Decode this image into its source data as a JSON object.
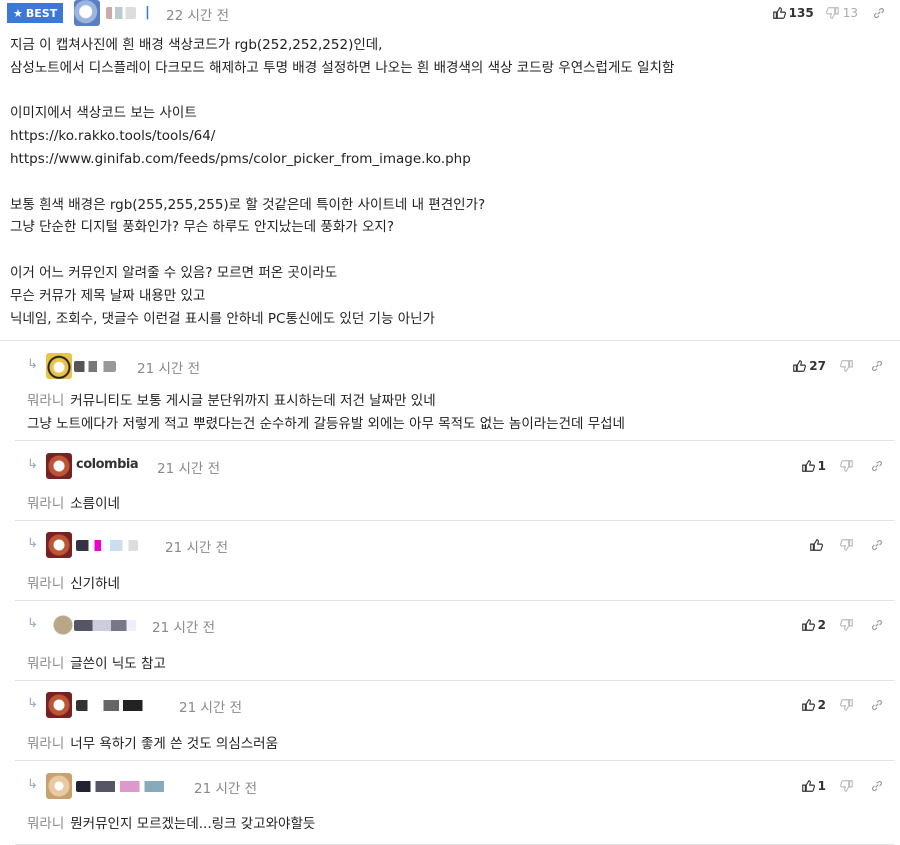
{
  "best": {
    "badge": "BEST",
    "time": "22 시간 전",
    "separator": "|",
    "likes": "135",
    "dislikes": "13",
    "lines": [
      "지금 이 캡쳐사진에 흰 배경 색상코드가 rgb(252,252,252)인데,",
      "삼성노트에서 디스플레이 다크모드 해제하고 투명 배경 설정하면 나오는 흰 배경색의 색상 코드랑 우연스럽게도 일치함",
      "",
      "이미지에서 색상코드 보는 사이트",
      "https://ko.rakko.tools/tools/64/",
      "https://www.ginifab.com/feeds/pms/color_picker_from_image.ko.php",
      "",
      "보통 흰색 배경은 rgb(255,255,255)로 할 것같은데 특이한 사이트네 내 편견인가?",
      "그냥 단순한 디지털 풍화인가? 무슨 하루도 안지났는데 풍화가 오지?",
      "",
      "이거 어느 커뮤인지 알려줄 수 있음? 모르면 퍼온 곳이라도",
      "무슨 커뮤가 제목 날짜 내용만 있고",
      "닉네임, 조회수, 댓글수 이런걸 표시를 안하네 PC통신에도 있던 기능 아닌가"
    ]
  },
  "replies": [
    {
      "time": "21 시간 전",
      "likes": "27",
      "prefix": "뭐라니",
      "lines": [
        "커뮤니티도 보통 게시글 분단위까지 표시하는데 저건 날짜만 있네",
        "그냥 노트에다가 저렇게 적고 뿌렸다는건 순수하게 갈등유발 외에는 아무 목적도 없는 놈이라는건데 무섭네"
      ]
    },
    {
      "nickname": "colombia",
      "time": "21 시간 전",
      "likes": "1",
      "prefix": "뭐라니",
      "lines": [
        "소름이네"
      ]
    },
    {
      "time": "21 시간 전",
      "likes": "",
      "prefix": "뭐라니",
      "lines": [
        "신기하네"
      ]
    },
    {
      "time": "21 시간 전",
      "likes": "2",
      "prefix": "뭐라니",
      "lines": [
        "글쓴이 닉도 참고"
      ]
    },
    {
      "time": "21 시간 전",
      "likes": "2",
      "prefix": "뭐라니",
      "lines": [
        "너무 욕하기 좋게 쓴 것도 의심스러움"
      ]
    },
    {
      "time": "21 시간 전",
      "likes": "1",
      "prefix": "뭐라니",
      "lines": [
        "뭔커뮤인지 모르겠는데...링크 갖고와야할듯"
      ]
    }
  ],
  "icons": {
    "like": "thumbs-up-icon",
    "dislike": "thumbs-down-icon",
    "link": "link-icon",
    "reply": "reply-arrow-icon",
    "star": "star-icon"
  },
  "colors": {
    "accent": "#3b78d8",
    "muted": "#8a8a8a"
  }
}
